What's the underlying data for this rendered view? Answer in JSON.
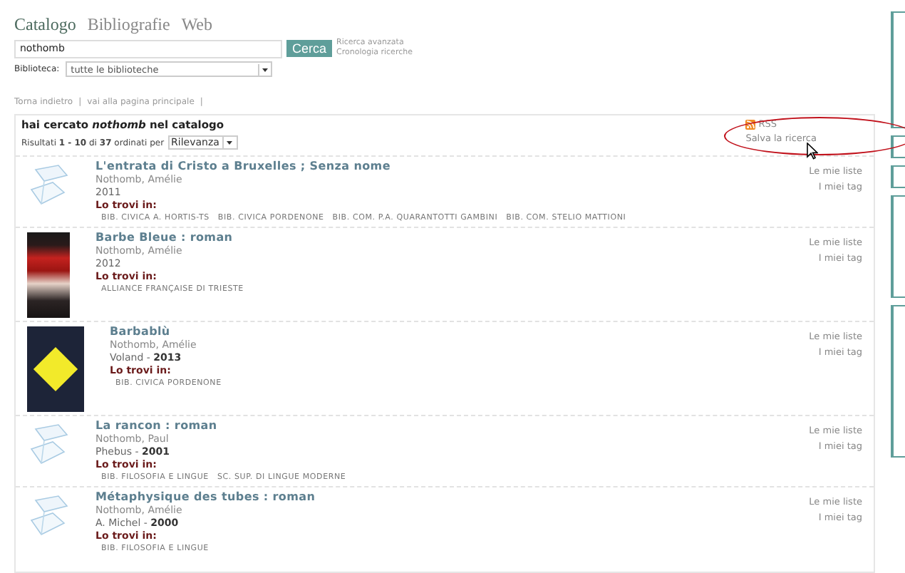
{
  "tabs": [
    {
      "label": "Catalogo",
      "selected": true
    },
    {
      "label": "Bibliografie",
      "selected": false
    },
    {
      "label": "Web",
      "selected": false
    }
  ],
  "search": {
    "value": "nothomb",
    "button": "Cerca",
    "links": [
      "Ricerca avanzata",
      "Cronologia ricerche"
    ]
  },
  "library_filter": {
    "label": "Biblioteca:",
    "value": "tutte le biblioteche"
  },
  "nav_links": [
    {
      "label": "Torna indietro",
      "separator": "|"
    },
    {
      "label": "vai alla pagina principale",
      "separator": "|"
    }
  ],
  "results": {
    "heading": "hai cercato *nothomb* nel catalogo",
    "summary": "Risultati **1 - 10** di **37** ordinati per",
    "sort": "Rilevanza",
    "rss": "RSS",
    "save_search": "Salva la ricerca",
    "records": [
      {
        "kind": "placeholder",
        "title": "L'entrata di Cristo a Bruxelles ; Senza nome",
        "author": "Nothomb, Amélie",
        "edition": "2011",
        "found_label": "Lo trovi in:",
        "libraries": [
          "BIB. CIVICA A. HORTIS-TS",
          "BIB. CIVICA PORDENONE",
          "BIB. COM. P.A. QUARANTOTTI GAMBINI",
          "BIB. COM. STELIO MATTIONI"
        ],
        "actions": [
          "Le mie liste",
          "I miei tag"
        ]
      },
      {
        "kind": "photo",
        "title": "Barbe Bleue : roman",
        "author": "Nothomb, Amélie",
        "edition": "2012",
        "found_label": "Lo trovi in:",
        "libraries": [
          "ALLIANCE FRANÇAISE DI TRIESTE"
        ],
        "actions": [
          "Le mie liste",
          "I miei tag"
        ]
      },
      {
        "kind": "artwork",
        "title": "Barbablù",
        "author": "Nothomb, Amélie",
        "edition": "Voland - **2013**",
        "found_label": "Lo trovi in:",
        "libraries": [
          "BIB. CIVICA PORDENONE"
        ],
        "actions": [
          "Le mie liste",
          "I miei tag"
        ]
      },
      {
        "kind": "placeholder",
        "title": "La rancon : roman",
        "author": "Nothomb, Paul",
        "edition": "Phebus - **2001**",
        "found_label": "Lo trovi in:",
        "libraries": [
          "BIB. FILOSOFIA E LINGUE",
          "SC. SUP. DI LINGUE MODERNE"
        ],
        "actions": [
          "Le mie liste",
          "I miei tag"
        ]
      },
      {
        "kind": "placeholder",
        "title": "Métaphysique des tubes : roman",
        "author": "Nothomb, Amélie",
        "edition": "A. Michel - **2000**",
        "found_label": "Lo trovi in:",
        "libraries": [
          "BIB. FILOSOFIA E LINGUE"
        ],
        "actions": [
          "Le mie liste",
          "I miei tag"
        ]
      }
    ]
  }
}
